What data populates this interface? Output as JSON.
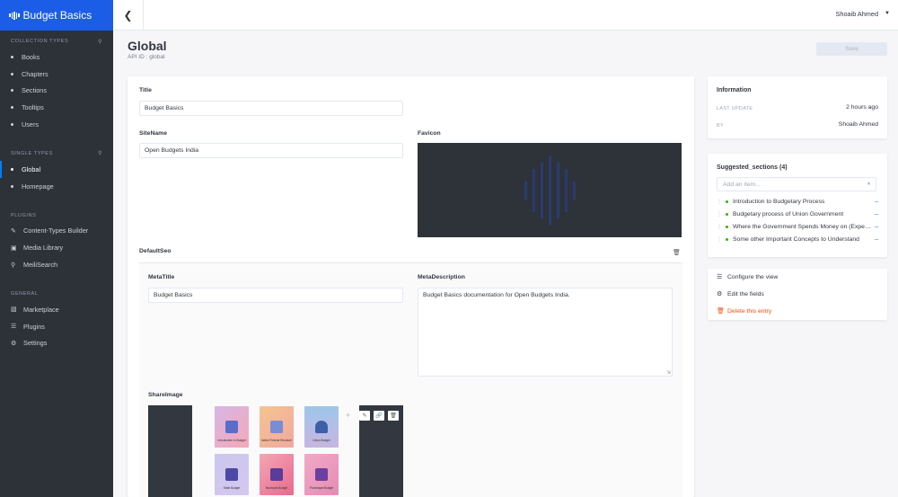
{
  "brand": {
    "title": "Budget Basics"
  },
  "sidebar": {
    "collection_title": "COLLECTION TYPES",
    "collection_items": [
      "Books",
      "Chapters",
      "Sections",
      "Tooltips",
      "Users"
    ],
    "single_title": "SINGLE TYPES",
    "single_items": [
      "Global",
      "Homepage"
    ],
    "plugins_title": "PLUGINS",
    "plugin_items": [
      "Content-Types Builder",
      "Media Library",
      "MeiliSearch"
    ],
    "general_title": "GENERAL",
    "general_items": [
      "Marketplace",
      "Plugins",
      "Settings"
    ]
  },
  "topbar": {
    "user": "Shoaib Ahmed"
  },
  "header": {
    "title": "Global",
    "api_id": "API ID : global",
    "save_label": "Save"
  },
  "form": {
    "title_label": "Title",
    "title_value": "Budget Basics",
    "sitename_label": "SiteName",
    "sitename_value": "Open Budgets India",
    "favicon_label": "Favicon",
    "defaultseo_label": "DefaultSeo",
    "metatitle_label": "MetaTitle",
    "metatitle_value": "Budget Basics",
    "metadescription_label": "MetaDescription",
    "metadescription_value": "Budget Basics documentation for Open Budgets India.",
    "shareimage_label": "ShareImage",
    "thumbs": [
      "Introduction to Budget",
      "Indian Federal Structure",
      "Union Budget",
      "State Budget",
      "Municipal Budget",
      "Panchayat Budget"
    ]
  },
  "info": {
    "title": "Information",
    "last_update_label": "LAST UPDATE",
    "last_update_value": "2 hours ago",
    "by_label": "BY",
    "by_value": "Shoaib Ahmed"
  },
  "suggested": {
    "title": "Suggested_sections (4)",
    "placeholder": "Add an item...",
    "items": [
      "Introduction to Budgetary Process",
      "Budgetary process of Union Government",
      "Where the Government Spends Money on (Expenditure)",
      "Some other Important Concepts to Understand"
    ]
  },
  "actions": {
    "configure": "Configure the view",
    "edit_fields": "Edit the fields",
    "delete": "Delete this entry"
  },
  "colors": {
    "accent": "#007eff",
    "sidebar_bg": "#2d3138",
    "brand_bg": "#1c5de7",
    "danger": "#f64d0a",
    "status": "#27b70a"
  }
}
